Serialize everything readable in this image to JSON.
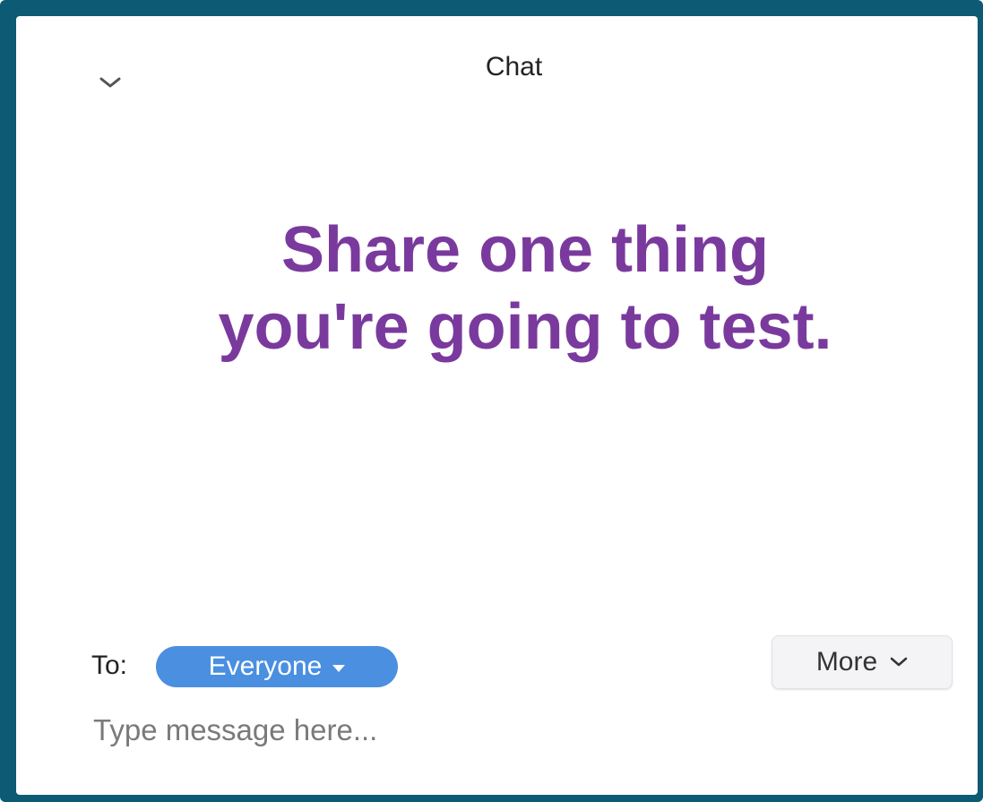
{
  "chat_panel": {
    "title": "Chat",
    "prompt_line1": "Share one thing",
    "prompt_line2": "you're going to test.",
    "to_label": "To:",
    "recipient": "Everyone",
    "more_label": "More",
    "message_placeholder": "Type message here...",
    "icons": {
      "collapse": "chevron-down-icon",
      "recipient_dropdown": "caret-down-icon",
      "more_dropdown": "chevron-down-icon"
    },
    "colors": {
      "frame": "#0c5a73",
      "prompt_text": "#7a3a9d",
      "recipient_pill": "#4a8fe0"
    }
  }
}
